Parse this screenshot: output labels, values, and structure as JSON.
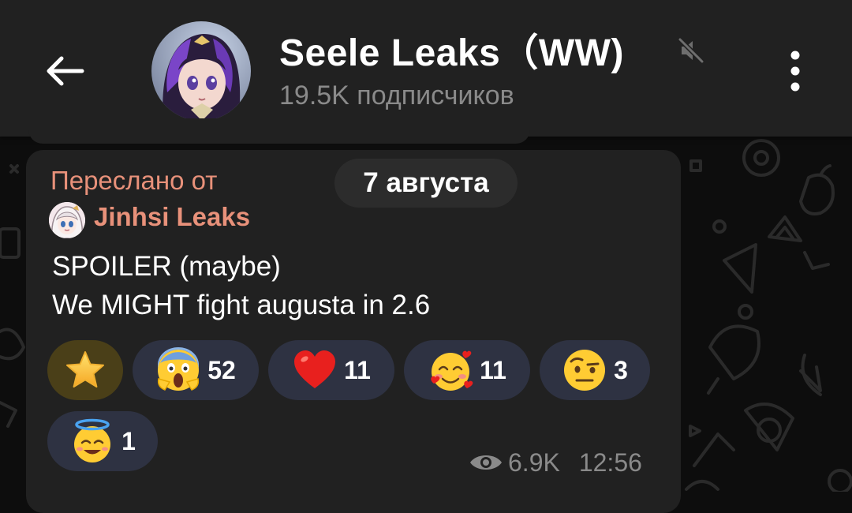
{
  "channel": {
    "title": "Seele Leaks（WW)",
    "subtitle": "19.5K подписчиков",
    "muted": true
  },
  "message": {
    "date": "7 августа",
    "forwarded_label": "Переслано от",
    "forwarded_from": "Jinhsi Leaks",
    "lines": [
      "SPOILER (maybe)",
      "We MIGHT fight augusta in 2.6"
    ],
    "reactions": [
      {
        "emoji": "star-icon",
        "count": "",
        "selected": true
      },
      {
        "emoji": "screaming-face-icon",
        "count": "52"
      },
      {
        "emoji": "red-heart-icon",
        "count": "11"
      },
      {
        "emoji": "smiling-face-with-hearts-icon",
        "count": "11"
      },
      {
        "emoji": "face-with-raised-eyebrow-icon",
        "count": "3"
      },
      {
        "emoji": "smiling-face-with-halo-icon",
        "count": "1"
      }
    ],
    "views": "6.9K",
    "time": "12:56"
  },
  "colors": {
    "header_bg": "#212121",
    "bubble_bg": "#212121",
    "forward_accent": "#e8917a",
    "reaction_bg": "#2e3242",
    "reaction_selected_bg": "#4a3f18",
    "muted_text": "#8a8a8a"
  }
}
